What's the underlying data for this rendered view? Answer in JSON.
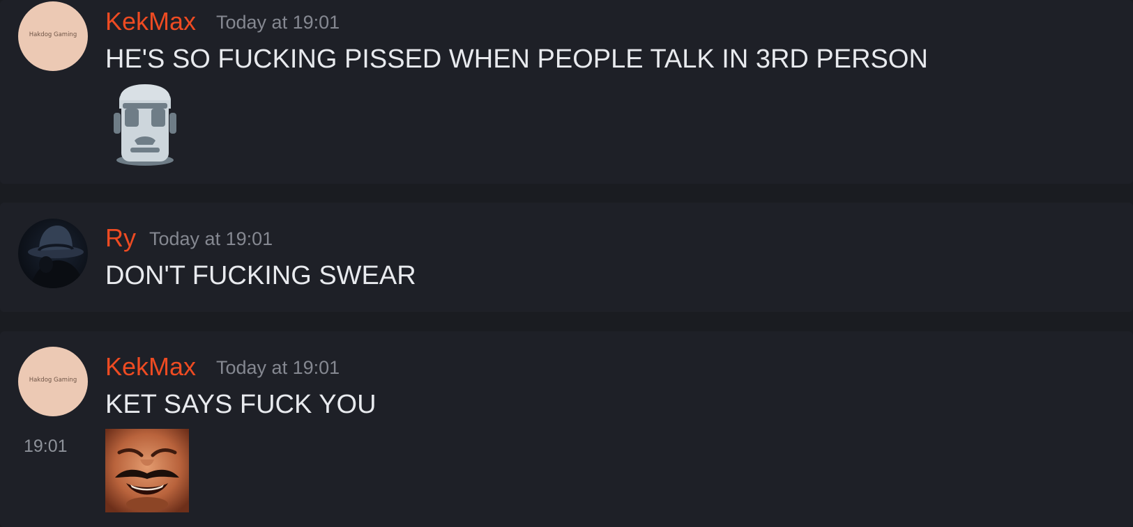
{
  "messages": [
    {
      "author": "KekMax",
      "avatar_text": "Hakdog Gaming",
      "timestamp": "Today at 19:01",
      "content": "HE'S SO FUCKING PISSED WHEN PEOPLE TALK IN 3RD PERSON",
      "attachment": "moai-emoji"
    },
    {
      "author": "Ry",
      "avatar_text": "",
      "timestamp": "Today at 19:01",
      "content": "DON'T FUCKING SWEAR"
    },
    {
      "author": "KekMax",
      "avatar_text": "Hakdog Gaming",
      "timestamp": "Today at 19:01",
      "content": "KET SAYS FUCK YOU",
      "hover_time": "19:01",
      "attachment": "laughing-man-emoji"
    }
  ],
  "colors": {
    "background": "#1a1c21",
    "message_background": "#1e2027",
    "username": "#ee4b22",
    "timestamp": "#858891",
    "text": "#e8eaee"
  }
}
